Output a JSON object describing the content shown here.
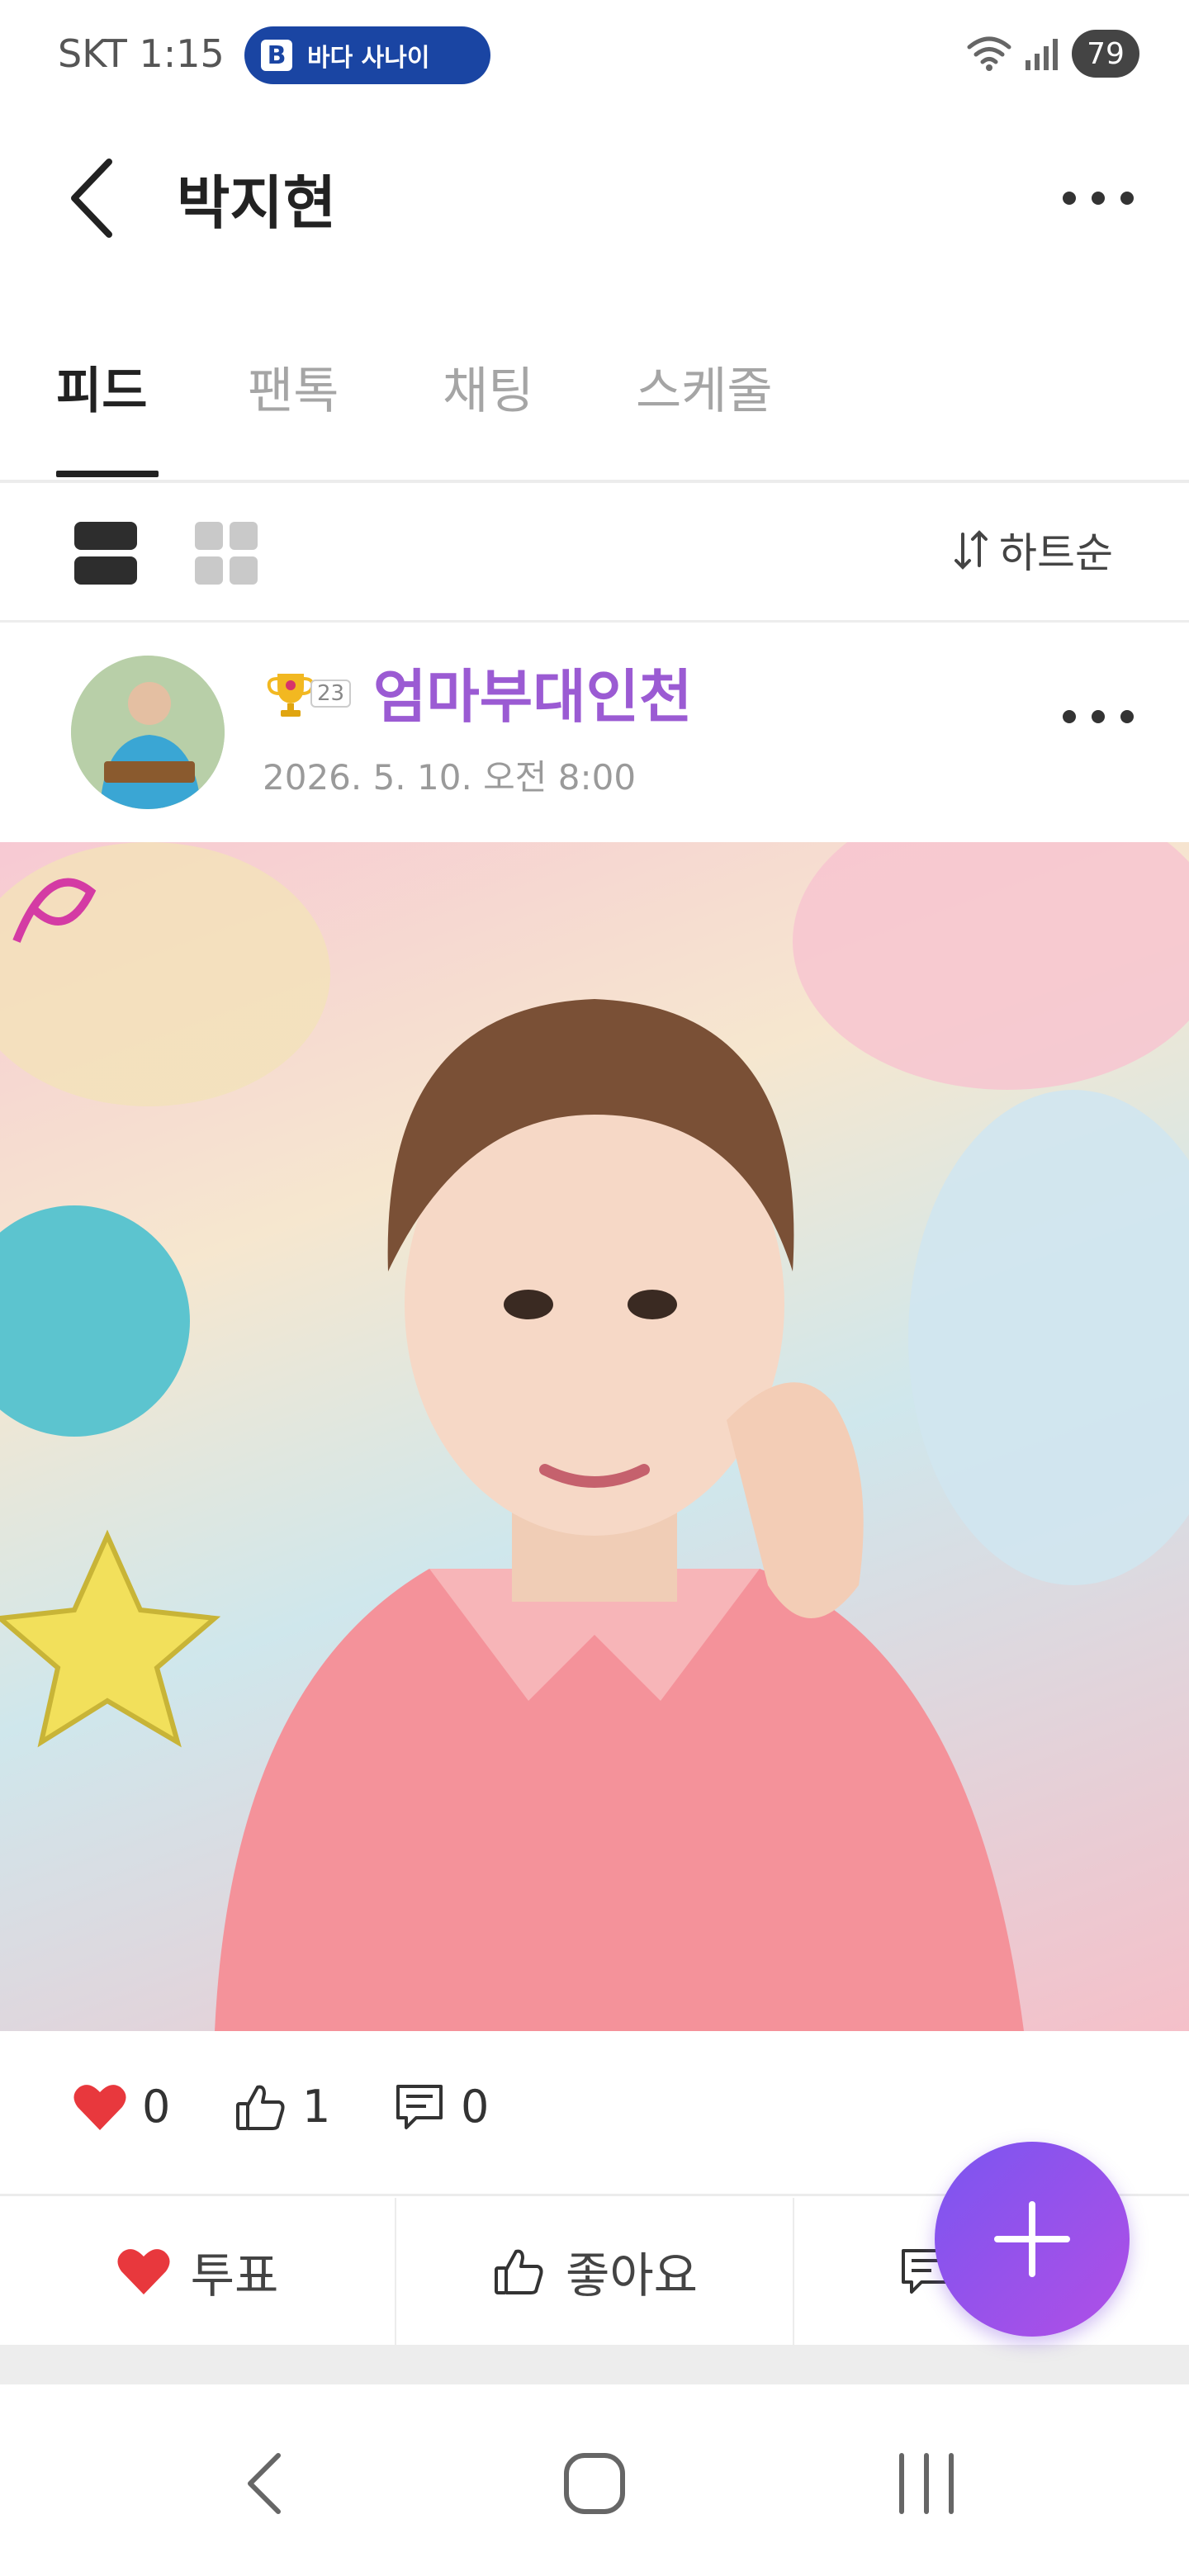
{
  "status_bar": {
    "time": "SKT 1:15",
    "badge_logo": "B",
    "badge_text": "바다 사나이",
    "battery": "79"
  },
  "header": {
    "title": "박지현"
  },
  "tabs": [
    {
      "label": "피드",
      "active": true
    },
    {
      "label": "팬톡",
      "active": false
    },
    {
      "label": "채팅",
      "active": false
    },
    {
      "label": "스케줄",
      "active": false
    }
  ],
  "view_bar": {
    "sort_label": "하트순"
  },
  "post": {
    "rank_badge": "23",
    "author": "엄마부대인천",
    "date": "2026. 5. 10. 오전 8:00",
    "heart_count": "0",
    "like_count": "1",
    "comment_count": "0"
  },
  "actions": {
    "vote_label": "투표",
    "like_label": "좋아요"
  },
  "colors": {
    "accent_purple": "#9b5bd3",
    "heart_red": "#e8383d",
    "badge_blue": "#1a45a3",
    "fab_start": "#7b55f0",
    "fab_end": "#b04fe6"
  }
}
